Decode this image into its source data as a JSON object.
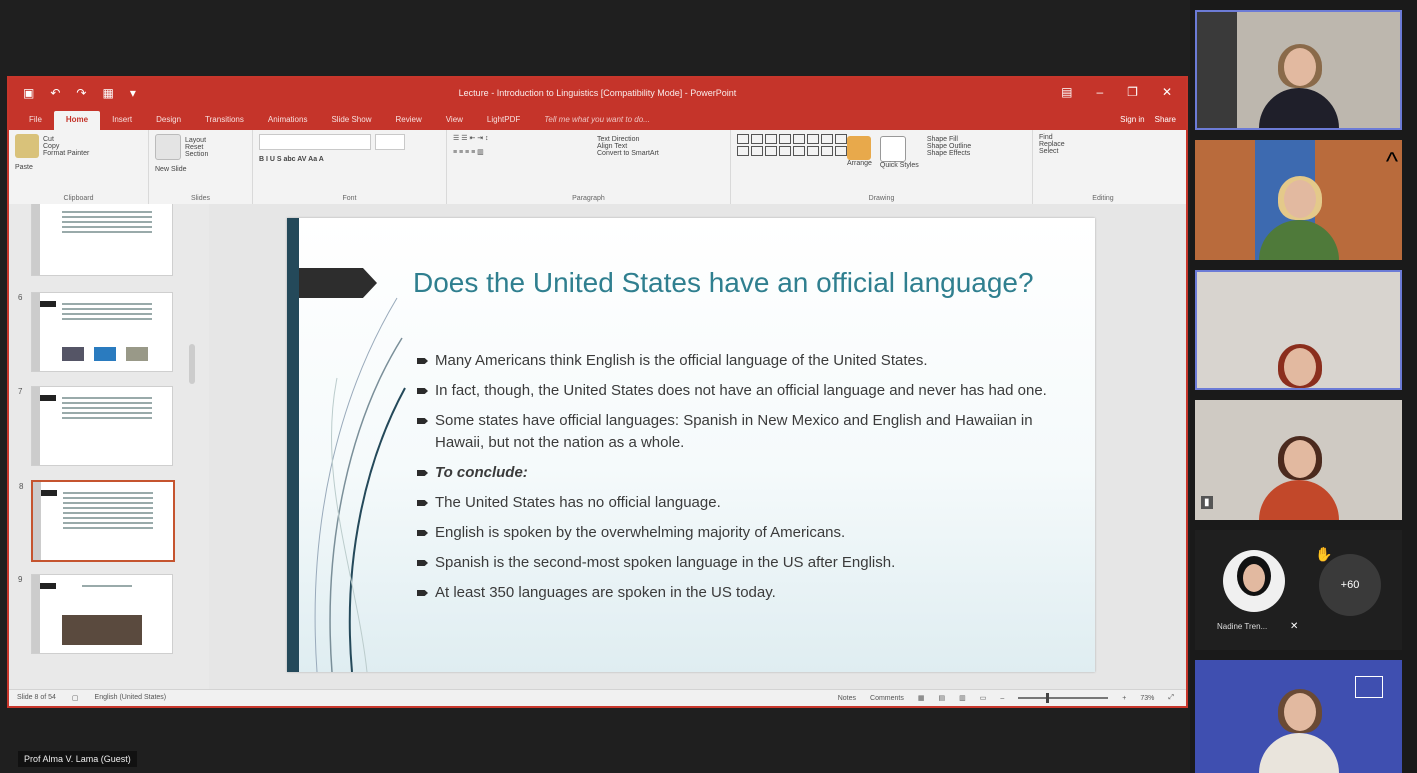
{
  "ppt": {
    "window_title": "Lecture - Introduction to Linguistics [Compatibility Mode] - PowerPoint",
    "tabs": [
      "File",
      "Home",
      "Insert",
      "Design",
      "Transitions",
      "Animations",
      "Slide Show",
      "Review",
      "View",
      "LightPDF"
    ],
    "tell_me": "Tell me what you want to do...",
    "sign_in": "Sign in",
    "share": "Share",
    "ribbon": {
      "clipboard": {
        "label": "Clipboard",
        "paste": "Paste",
        "cut": "Cut",
        "copy": "Copy",
        "format_painter": "Format Painter"
      },
      "slides": {
        "label": "Slides",
        "new_slide": "New Slide",
        "layout": "Layout",
        "reset": "Reset",
        "section": "Section"
      },
      "font": {
        "label": "Font"
      },
      "paragraph": {
        "label": "Paragraph",
        "text_direction": "Text Direction",
        "align_text": "Align Text",
        "convert_smartart": "Convert to SmartArt"
      },
      "drawing": {
        "label": "Drawing",
        "arrange": "Arrange",
        "quick_styles": "Quick Styles",
        "shape_fill": "Shape Fill",
        "shape_outline": "Shape Outline",
        "shape_effects": "Shape Effects"
      },
      "editing": {
        "label": "Editing",
        "find": "Find",
        "replace": "Replace",
        "select": "Select"
      }
    },
    "thumbnails": [
      {
        "num": "",
        "selected": false
      },
      {
        "num": "6",
        "selected": false
      },
      {
        "num": "7",
        "selected": false
      },
      {
        "num": "8",
        "selected": true
      },
      {
        "num": "9",
        "selected": false
      }
    ],
    "slide": {
      "title": "Does the United States have an official language?",
      "bullets": [
        {
          "text": "Many Americans think English is the official language of the United States.",
          "emphasis": false
        },
        {
          "text": "In fact, though, the United States does not have an official language and never has had one.",
          "emphasis": false
        },
        {
          "text": "Some states have official languages: Spanish in New Mexico and English and Hawaiian in Hawaii, but not the nation as a whole.",
          "emphasis": false
        },
        {
          "text": "To conclude:",
          "emphasis": true
        },
        {
          "text": "The United States has no official language.",
          "emphasis": false
        },
        {
          "text": "English is spoken by the overwhelming majority of Americans.",
          "emphasis": false
        },
        {
          "text": "Spanish is the second-most spoken language in the US after English.",
          "emphasis": false
        },
        {
          "text": "At least 350 languages are spoken in the US today.",
          "emphasis": false
        }
      ]
    },
    "status": {
      "slide_of": "Slide 8 of 54",
      "language": "English (United States)",
      "notes": "Notes",
      "comments": "Comments",
      "zoom": "73%"
    }
  },
  "meeting": {
    "presenter_name": "Prof Alma V. Lama (Guest)",
    "participant_name": "Nadine Tren...",
    "more_count": "+60"
  }
}
